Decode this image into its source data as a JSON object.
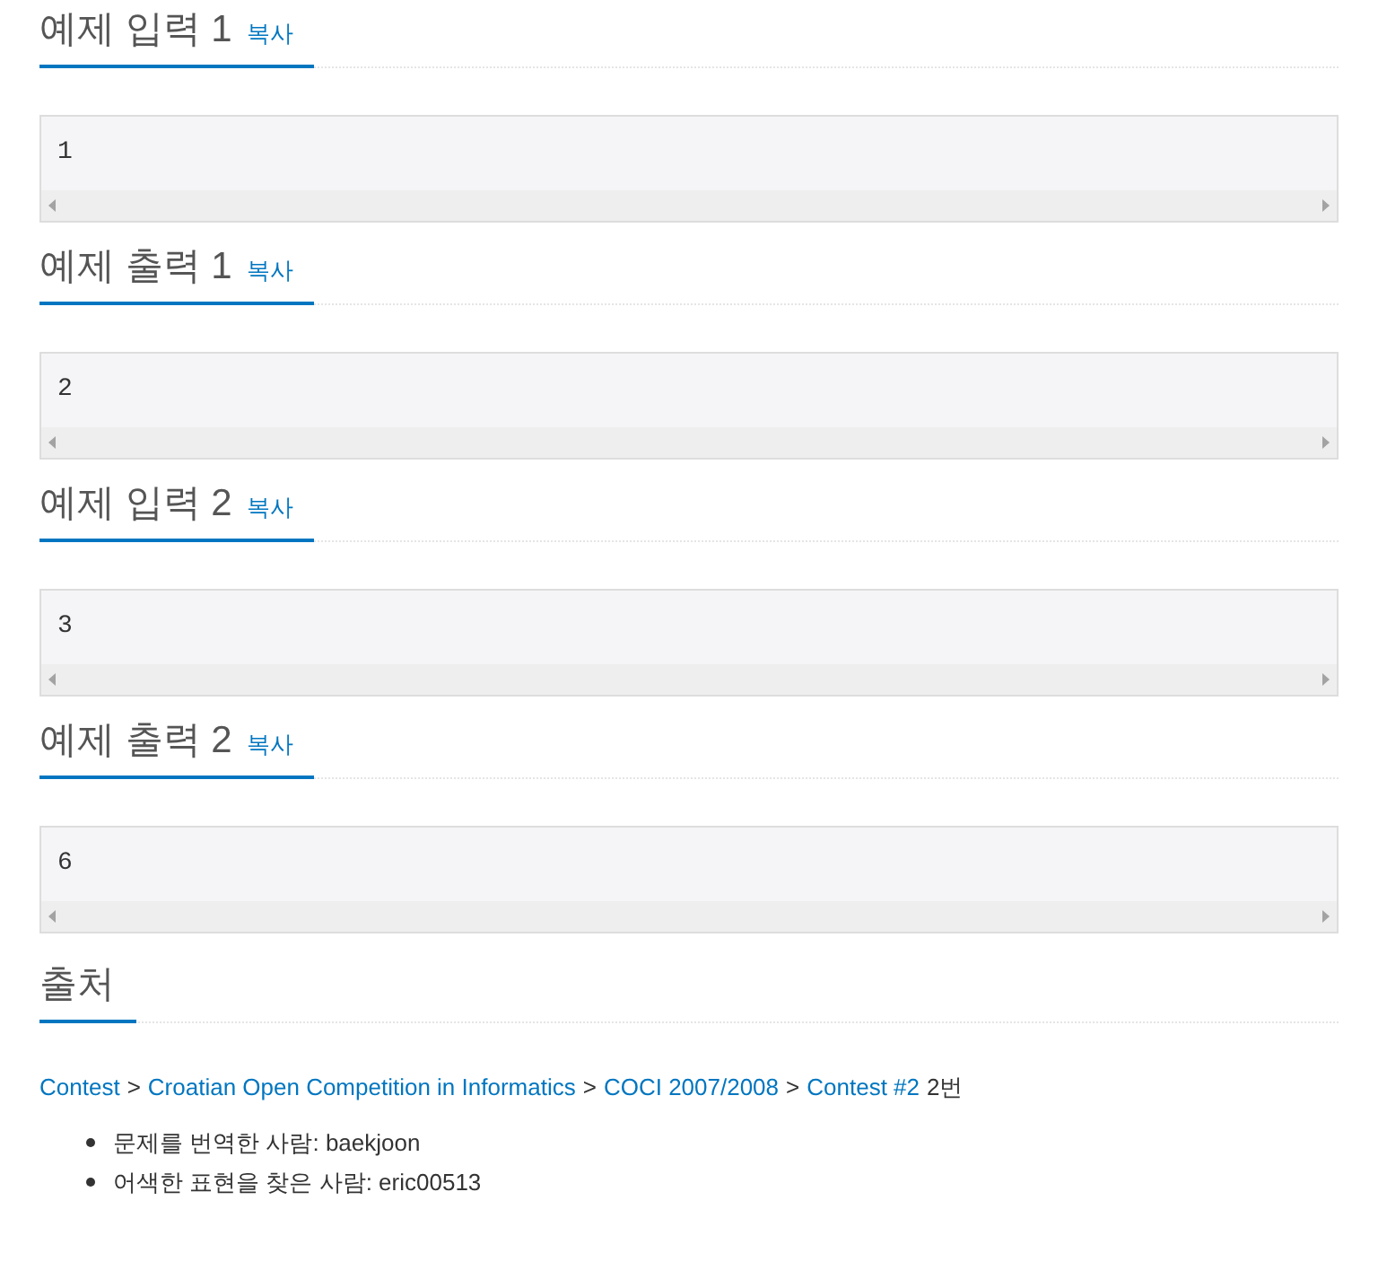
{
  "samples": [
    {
      "title": "예제 입력 1",
      "copy": "복사",
      "content": "1"
    },
    {
      "title": "예제 출력 1",
      "copy": "복사",
      "content": "2"
    },
    {
      "title": "예제 입력 2",
      "copy": "복사",
      "content": "3"
    },
    {
      "title": "예제 출력 2",
      "copy": "복사",
      "content": "6"
    }
  ],
  "source": {
    "title": "출처",
    "breadcrumb": [
      {
        "kind": "link",
        "text": "Contest"
      },
      {
        "kind": "separator",
        "text": ">"
      },
      {
        "kind": "link",
        "text": "Croatian Open Competition in Informatics"
      },
      {
        "kind": "separator",
        "text": ">"
      },
      {
        "kind": "link",
        "text": "COCI 2007/2008"
      },
      {
        "kind": "separator",
        "text": ">"
      },
      {
        "kind": "link",
        "text": "Contest #2"
      },
      {
        "kind": "text",
        "text": "2번"
      }
    ],
    "credits": [
      "문제를 번역한 사람: baekjoon",
      "어색한 표현을 찾은 사람: eric00513"
    ]
  }
}
